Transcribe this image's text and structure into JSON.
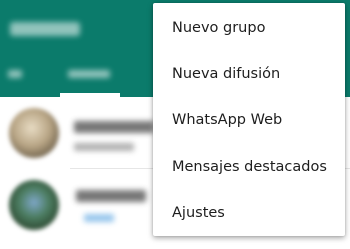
{
  "theme": {
    "appbar_color": "#0b7b6b",
    "menu_background": "#ffffff",
    "menu_text_color": "#1e1e1e"
  },
  "overflow_menu": {
    "items": [
      {
        "label": "Nuevo grupo"
      },
      {
        "label": "Nueva difusión"
      },
      {
        "label": "WhatsApp Web"
      },
      {
        "label": "Mensajes destacados"
      },
      {
        "label": "Ajustes"
      }
    ]
  }
}
